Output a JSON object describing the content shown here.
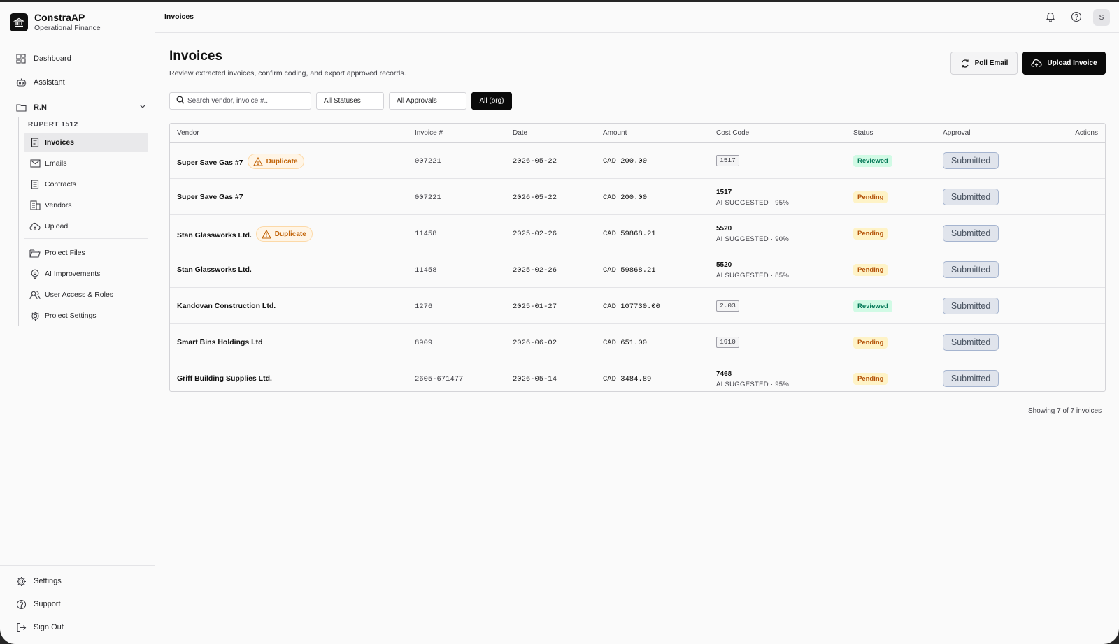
{
  "brand": {
    "name": "ConstraAP",
    "subtitle": "Operational Finance"
  },
  "nav": {
    "dashboard": "Dashboard",
    "assistant": "Assistant",
    "project_folder": "R.N",
    "project_label": "RUPERT 1512",
    "sub_items": [
      "Invoices",
      "Emails",
      "Contracts",
      "Vendors",
      "Upload",
      "Project Files",
      "AI Improvements",
      "User Access & Roles",
      "Project Settings"
    ],
    "settings": "Settings",
    "support": "Support",
    "sign_out": "Sign Out"
  },
  "topbar": {
    "title": "Invoices",
    "avatar_initial": "S"
  },
  "page": {
    "title": "Invoices",
    "subtitle": "Review extracted invoices, confirm coding, and export approved records.",
    "poll_email": "Poll Email",
    "upload_invoice": "Upload Invoice"
  },
  "filters": {
    "search_placeholder": "Search vendor, invoice #...",
    "statuses": "All Statuses",
    "approvals": "All Approvals",
    "scope": "All (org)"
  },
  "table": {
    "columns": [
      "Vendor",
      "Invoice #",
      "Date",
      "Amount",
      "Cost Code",
      "Status",
      "Approval",
      "Actions"
    ],
    "duplicate_label": "Duplicate",
    "rows": [
      {
        "vendor": "Super Save Gas #7",
        "duplicate": true,
        "invoice": "007221",
        "date": "2026-05-22",
        "amount": "CAD 200.00",
        "cost_code": "1517",
        "ai": "",
        "status": "Reviewed",
        "approval": "Submitted"
      },
      {
        "vendor": "Super Save Gas #7",
        "duplicate": false,
        "invoice": "007221",
        "date": "2026-05-22",
        "amount": "CAD 200.00",
        "cost_code": "1517",
        "ai": "AI SUGGESTED · 95%",
        "status": "Pending",
        "approval": "Submitted"
      },
      {
        "vendor": "Stan Glassworks Ltd.",
        "duplicate": true,
        "invoice": "11458",
        "date": "2025-02-26",
        "amount": "CAD 59868.21",
        "cost_code": "5520",
        "ai": "AI SUGGESTED · 90%",
        "status": "Pending",
        "approval": "Submitted"
      },
      {
        "vendor": "Stan Glassworks Ltd.",
        "duplicate": false,
        "invoice": "11458",
        "date": "2025-02-26",
        "amount": "CAD 59868.21",
        "cost_code": "5520",
        "ai": "AI SUGGESTED · 85%",
        "status": "Pending",
        "approval": "Submitted"
      },
      {
        "vendor": "Kandovan Construction Ltd.",
        "duplicate": false,
        "invoice": "1276",
        "date": "2025-01-27",
        "amount": "CAD 107730.00",
        "cost_code": "2.03",
        "ai": "",
        "status": "Reviewed",
        "approval": "Submitted"
      },
      {
        "vendor": "Smart Bins Holdings Ltd",
        "duplicate": false,
        "invoice": "8909",
        "date": "2026-06-02",
        "amount": "CAD 651.00",
        "cost_code": "1910",
        "ai": "",
        "status": "Pending",
        "approval": "Submitted"
      },
      {
        "vendor": "Griff Building Supplies Ltd.",
        "duplicate": false,
        "invoice": "2605-671477",
        "date": "2026-05-14",
        "amount": "CAD 3484.89",
        "cost_code": "7468",
        "ai": "AI SUGGESTED · 95%",
        "status": "Pending",
        "approval": "Submitted"
      }
    ]
  },
  "footer": {
    "count_text": "Showing 7 of 7 invoices"
  },
  "colors": {
    "accent": "#0a0a0a",
    "reviewed": "#047857",
    "pending": "#b45309",
    "duplicate": "#c2650a"
  }
}
